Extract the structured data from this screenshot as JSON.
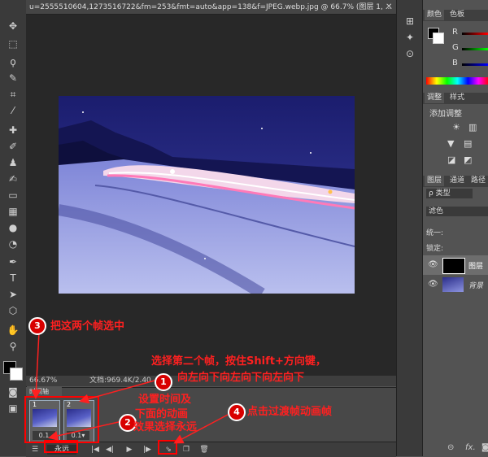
{
  "document": {
    "tab_title": "u=2555510604,1273516722&fm=253&fmt=auto&app=138&f=JPEG.webp.jpg @ 66.7% (图层 1, ..."
  },
  "status": {
    "zoom": "66.67%",
    "doc_size": "文档:969.4K/2.40"
  },
  "timeline": {
    "tab_label": "时间轴",
    "frames": [
      {
        "num": "1",
        "duration": "0.1"
      },
      {
        "num": "2",
        "duration": "0.1▾"
      }
    ],
    "loop_value": "永远"
  },
  "panels": {
    "color_tab": "颜色",
    "swatches_tab": "色板",
    "channel_r": "R",
    "channel_g": "G",
    "channel_b": "B",
    "adjust_tab": "调整",
    "style_tab": "样式",
    "add_adjustment": "添加调整",
    "layers_tab": "图层",
    "channels_tab": "通道",
    "paths_tab": "路径",
    "kind_filter": "ρ 类型",
    "blend_mode": "滤色",
    "unify_label": "统一:",
    "lock_label": "锁定:",
    "layers": [
      {
        "name": "图层"
      },
      {
        "name": "背景"
      }
    ]
  },
  "annotations": {
    "step1_text": "选择第二个帧，按住Shift+方向键，",
    "step1_text2": "向左向下向左向下向左向下",
    "step2_text": "设置时间及",
    "step2_text2": "下面的动画",
    "step2_text3": "效果选择永远",
    "step3_text": "把这两个帧选中",
    "step4_text": "点击过渡帧动画帧",
    "badge1": "1",
    "badge2": "2",
    "badge3": "3",
    "badge4": "4"
  }
}
